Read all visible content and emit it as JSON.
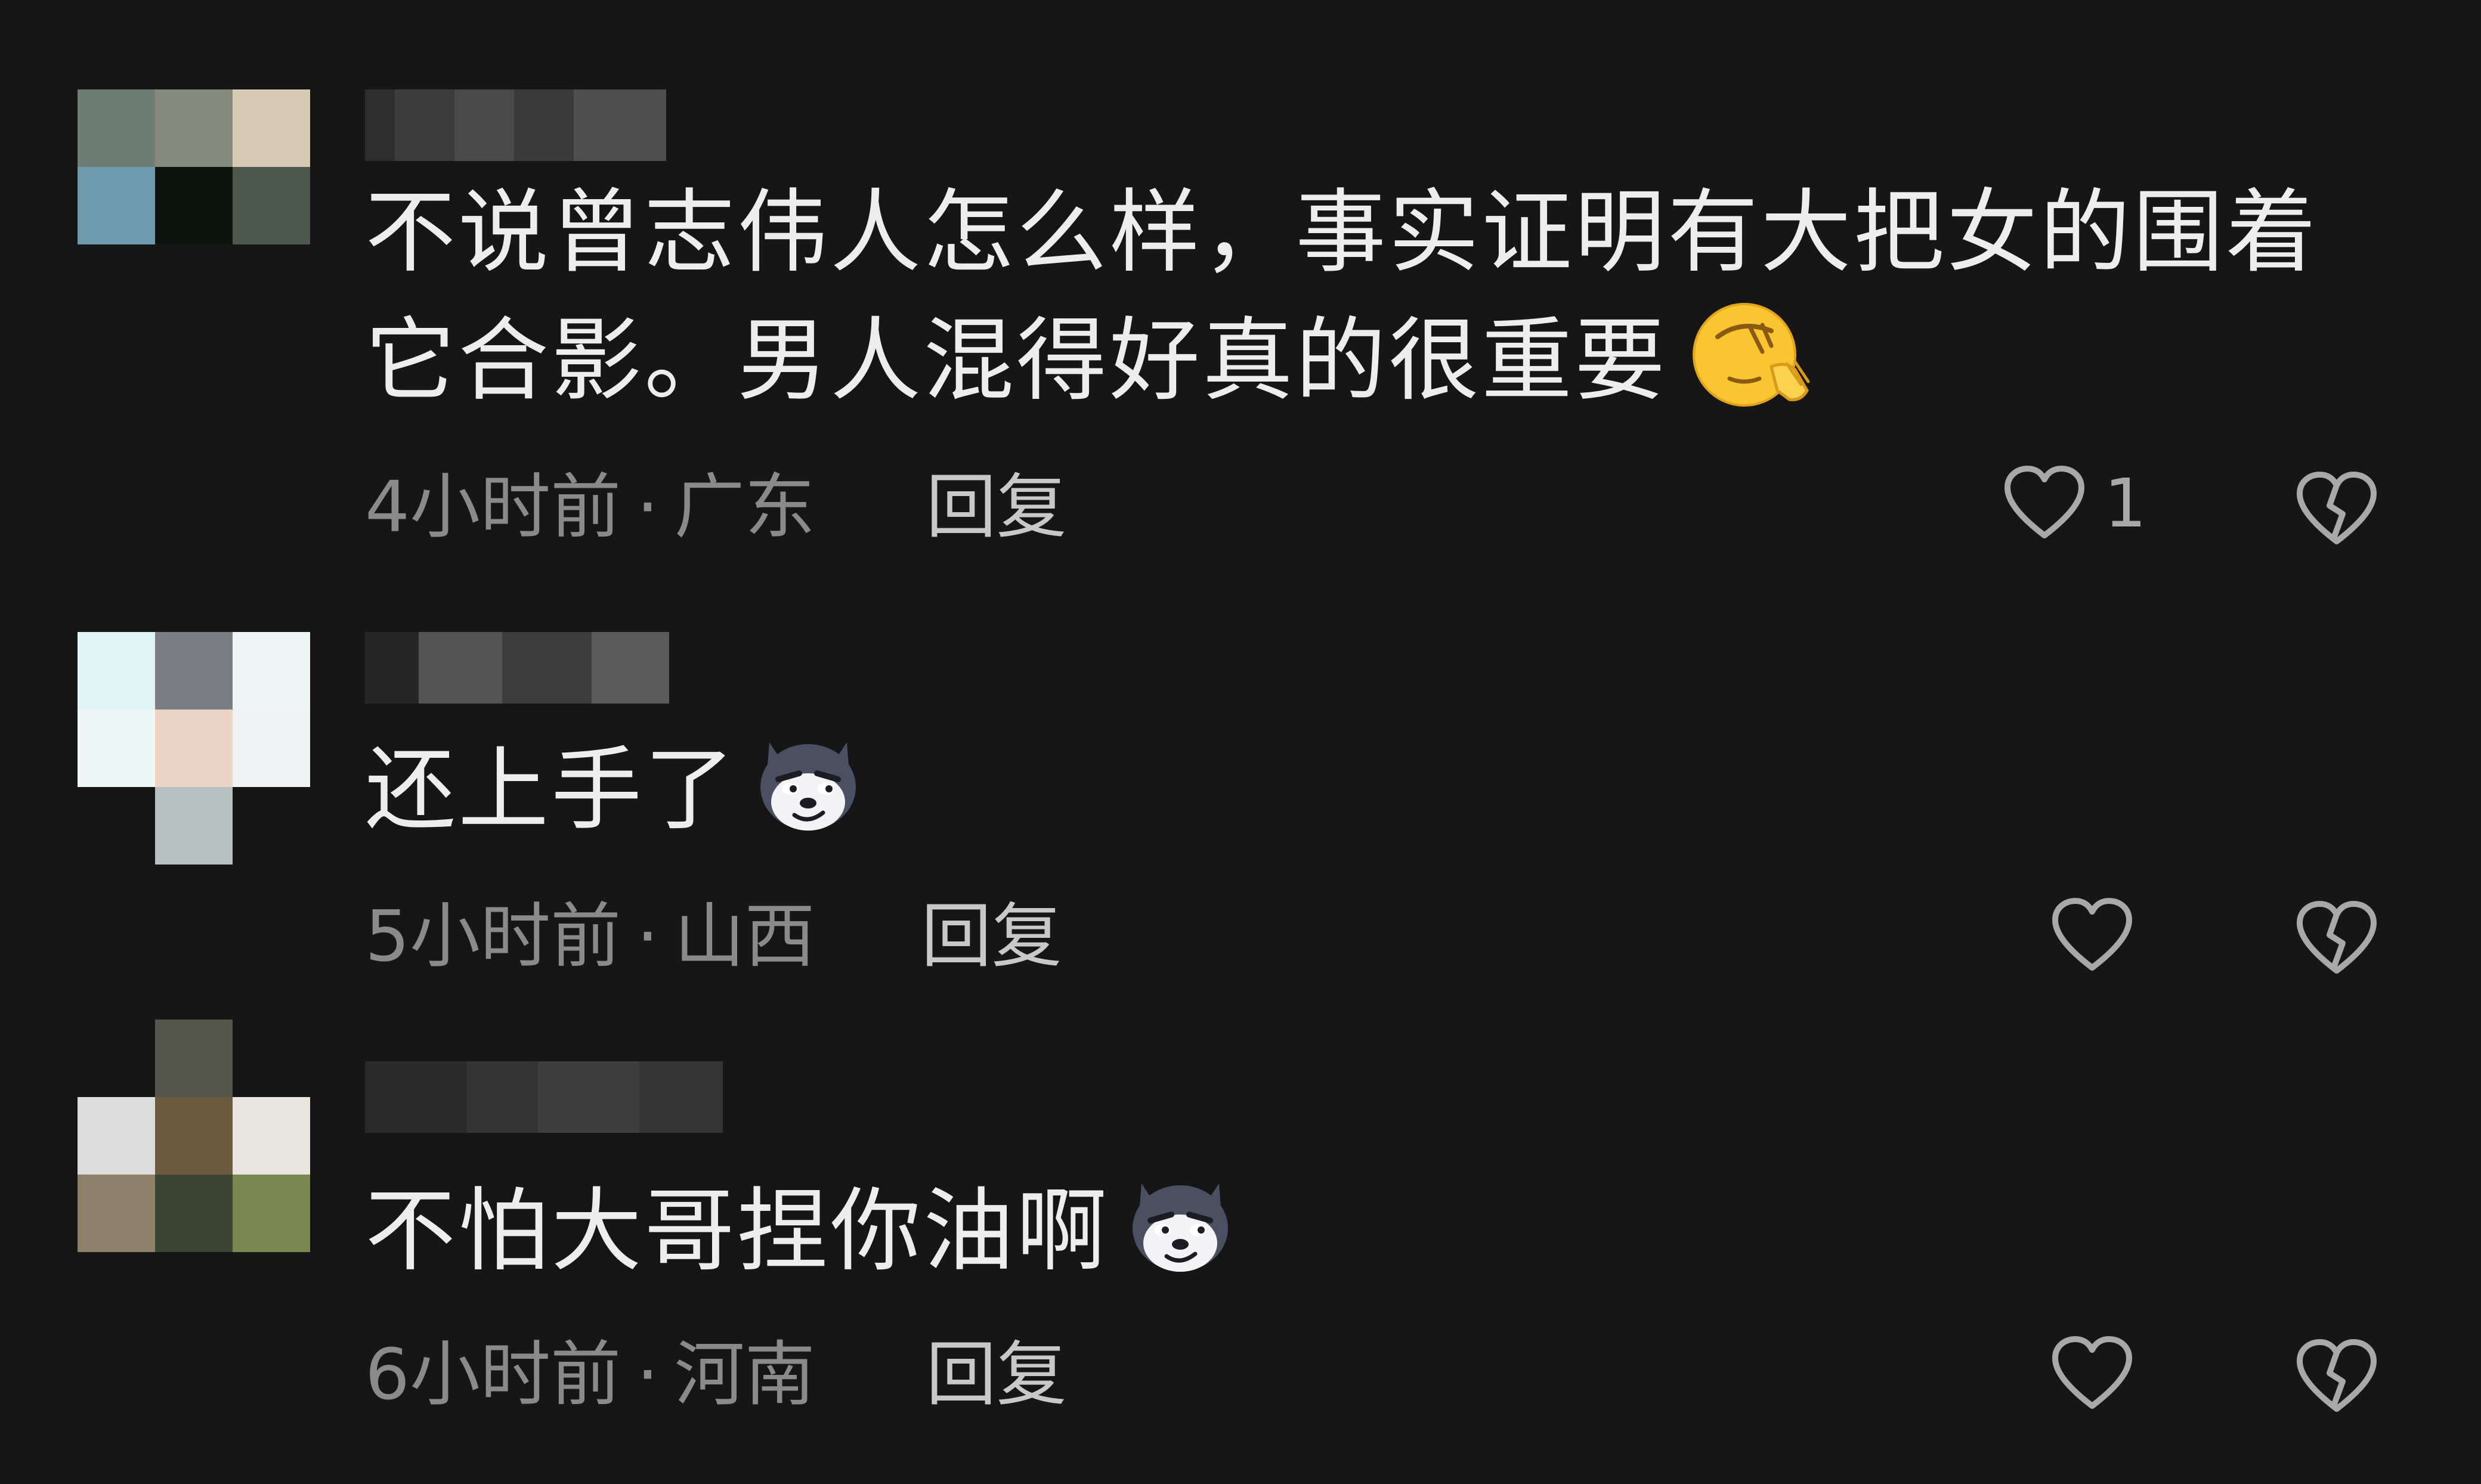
{
  "comments": [
    {
      "text": "不说曾志伟人怎么样，事实证明有大把女的围着它合影。男人混得好真的很重要",
      "emoji": "face-with-hand-over-eyes",
      "time": "4小时前",
      "location": "广东",
      "reply_label": "回复",
      "like_count": "1",
      "avatar_colors": [
        "#6f7e74",
        "#868a7c",
        "#d6ccb3",
        "#6e9bac",
        "#0d140f",
        "#4c574b",
        "#161616",
        "#161616",
        "#161616"
      ],
      "username_colors": [
        "#2d2d2d",
        "#3c3c3c",
        "#4a4a4a",
        "#3a3a3a",
        "#4e4e4e"
      ]
    },
    {
      "text": "还上手了",
      "emoji": "smug-husky",
      "time": "5小时前",
      "location": "山西",
      "reply_label": "回复",
      "like_count": "",
      "avatar_colors": [
        "#dff5f5",
        "#7a7d82",
        "#eef6f6",
        "#eef7f7",
        "#ecd3c4",
        "#f0f3f3",
        "#161616",
        "#b8c1c1",
        "#161616"
      ],
      "username_colors": [
        "#262626",
        "#545454",
        "#3d3d3d",
        "#595959",
        "#484848"
      ]
    },
    {
      "text": "不怕大哥捏你油啊",
      "emoji": "smug-husky",
      "time": "6小时前",
      "location": "河南",
      "reply_label": "回复",
      "like_count": "",
      "avatar_colors": [
        "#161616",
        "#55574c",
        "#161616",
        "#dcdcdc",
        "#6d5a3f",
        "#e8e4e0",
        "#8c8068",
        "#3a4631",
        "#7a8650"
      ],
      "username_colors": [
        "#2a2a2a",
        "#333333",
        "#3e3e3e",
        "#343434",
        "#2f2f2f"
      ]
    }
  ],
  "colors": {
    "background": "#161616",
    "text": "#ededed",
    "meta": "#8a8a8a",
    "reply": "#c8c8c8"
  }
}
